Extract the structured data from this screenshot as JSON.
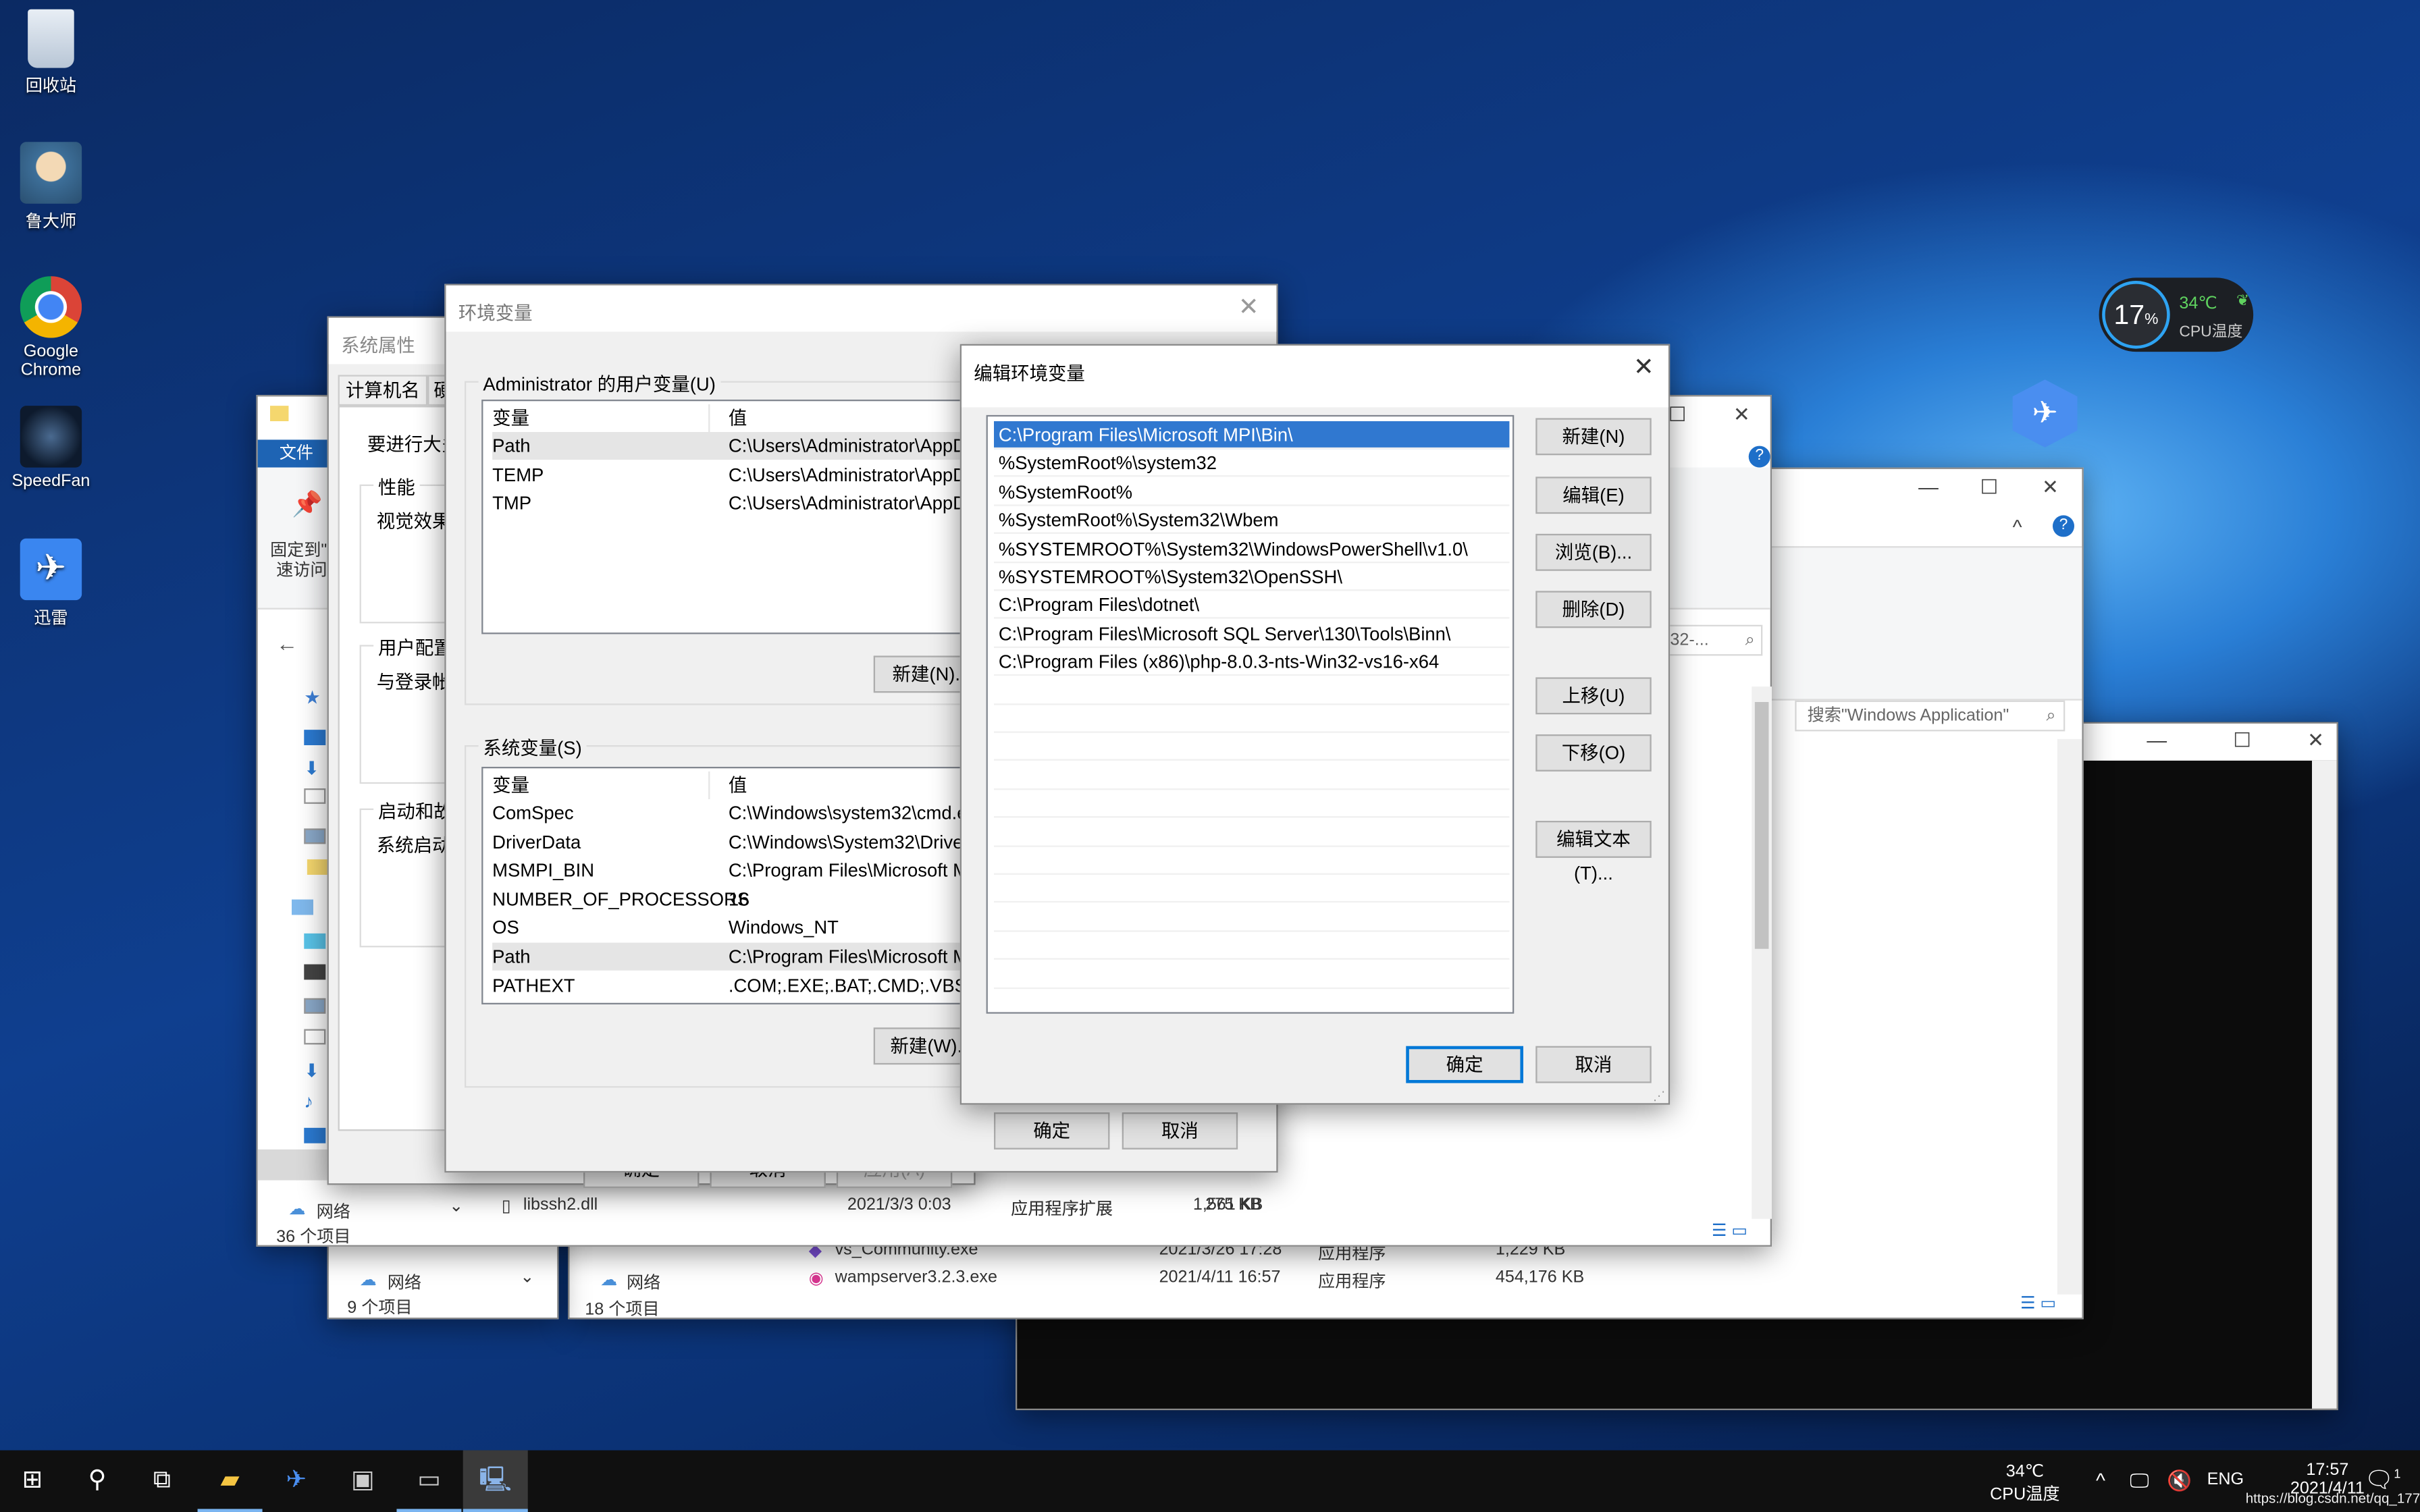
{
  "desktop": {
    "icons": [
      {
        "label": "回收站",
        "icon": "recycle-bin-icon"
      },
      {
        "label": "鲁大师",
        "icon": "ludashi-icon"
      },
      {
        "label": "Google Chrome",
        "icon": "chrome-icon"
      },
      {
        "label": "SpeedFan",
        "icon": "speedfan-icon"
      },
      {
        "label": "迅雷",
        "icon": "xunlei-icon"
      }
    ]
  },
  "cpu_widget": {
    "usage": "17",
    "usage_unit": "%",
    "temp": "34℃",
    "temp_label": "CPU温度"
  },
  "explorer_a": {
    "quick_tab": "文件",
    "pin_label_1": "固定到\"快",
    "pin_label_2": "速访问\"",
    "nav_network": "网络",
    "status": "36 个项目",
    "files": [
      {
        "name": "",
        "type": "应用程序扩展",
        "size": "1,561 KB"
      },
      {
        "name": "libssh2.dll",
        "date": "2021/3/3 0:03",
        "type": "应用程序扩展",
        "size": "275 KB"
      }
    ],
    "search_placeholder": "n32-..."
  },
  "explorer_b": {
    "search_placeholder": "搜索\"Windows Application\"",
    "nav_network": "网络",
    "status": "18 个项目",
    "files": [
      {
        "name": "vs_Community.exe",
        "date": "2021/3/26 17:28",
        "type": "应用程序",
        "size": "1,229 KB"
      },
      {
        "name": "wampserver3.2.3.exe",
        "date": "2021/4/11 16:57",
        "type": "应用程序",
        "size": "454,176 KB"
      }
    ]
  },
  "explorer_c": {
    "nav_network": "网络",
    "status": "9 个项目"
  },
  "sysprops": {
    "title": "系统属性",
    "tabs": [
      "计算机名",
      "硬"
    ],
    "intro": "要进行大多",
    "perf_label": "性能",
    "perf_text": "视觉效果，",
    "profile_label": "用户配置文",
    "profile_text": "与登录帐户",
    "startup_label": "启动和故障",
    "startup_text": "系统启动、",
    "ok": "确定",
    "cancel": "取消",
    "apply": "应用(A)"
  },
  "envvars": {
    "title": "环境变量",
    "user_group": "Administrator 的用户变量(U)",
    "col_var": "变量",
    "col_val": "值",
    "user_rows": [
      {
        "var": "Path",
        "val": "C:\\Users\\Administrator\\AppDat"
      },
      {
        "var": "TEMP",
        "val": "C:\\Users\\Administrator\\AppDat"
      },
      {
        "var": "TMP",
        "val": "C:\\Users\\Administrator\\AppDat"
      }
    ],
    "user_new": "新建(N)...",
    "sys_group": "系统变量(S)",
    "sys_rows": [
      {
        "var": "ComSpec",
        "val": "C:\\Windows\\system32\\cmd.exe"
      },
      {
        "var": "DriverData",
        "val": "C:\\Windows\\System32\\Drivers\\"
      },
      {
        "var": "MSMPI_BIN",
        "val": "C:\\Program Files\\Microsoft MP"
      },
      {
        "var": "NUMBER_OF_PROCESSORS",
        "val": "16"
      },
      {
        "var": "OS",
        "val": "Windows_NT"
      },
      {
        "var": "Path",
        "val": "C:\\Program Files\\Microsoft MP"
      },
      {
        "var": "PATHEXT",
        "val": ".COM;.EXE;.BAT;.CMD;.VBS;.VBE"
      }
    ],
    "sys_new": "新建(W)...",
    "ok": "确定",
    "cancel": "取消"
  },
  "editenv": {
    "title": "编辑环境变量",
    "entries": [
      "C:\\Program Files\\Microsoft MPI\\Bin\\",
      "%SystemRoot%\\system32",
      "%SystemRoot%",
      "%SystemRoot%\\System32\\Wbem",
      "%SYSTEMROOT%\\System32\\WindowsPowerShell\\v1.0\\",
      "%SYSTEMROOT%\\System32\\OpenSSH\\",
      "C:\\Program Files\\dotnet\\",
      "C:\\Program Files\\Microsoft SQL Server\\130\\Tools\\Binn\\",
      "C:\\Program Files (x86)\\php-8.0.3-nts-Win32-vs16-x64"
    ],
    "selected_index": 0,
    "buttons": {
      "new": "新建(N)",
      "edit": "编辑(E)",
      "browse": "浏览(B)...",
      "delete": "删除(D)",
      "up": "上移(U)",
      "down": "下移(O)",
      "edit_text": "编辑文本(T)..."
    },
    "ok": "确定",
    "cancel": "取消",
    "accent": "#3078d0"
  },
  "taskbar": {
    "temp": "34℃",
    "temp_label": "CPU温度",
    "lang": "ENG",
    "time": "17:57",
    "date": "2021/4/11",
    "watermark": "https://blog.csdn.net/qq_17790209",
    "notification_count": "1"
  }
}
